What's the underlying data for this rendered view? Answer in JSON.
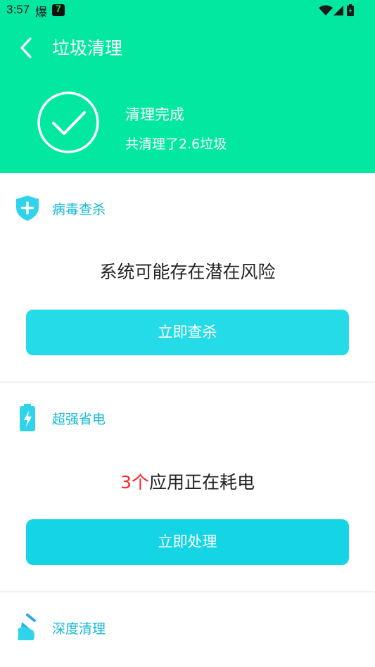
{
  "status_bar": {
    "time": "3:57",
    "notification_glyph": "爆",
    "app_badge": "7",
    "icons": [
      "wifi-icon",
      "signal-icon",
      "battery-icon"
    ]
  },
  "header": {
    "title": "垃圾清理",
    "back_icon": "chevron-left-icon"
  },
  "result": {
    "title": "清理完成",
    "subtitle": "共清理了2.6垃圾",
    "icon": "check-circle-icon"
  },
  "virus": {
    "label": "病毒查杀",
    "icon": "shield-plus-icon",
    "message": "系统可能存在潜在风险",
    "button": "立即查杀"
  },
  "power": {
    "label": "超强省电",
    "icon": "battery-bolt-icon",
    "message_count": "3个",
    "message_rest": "应用正在耗电",
    "button": "立即处理"
  },
  "deep": {
    "label": "深度清理",
    "icon": "broom-icon"
  },
  "colors": {
    "header_bg": "#03e8a0",
    "accent": "#17b8d4",
    "button_bg": "#26dbe8",
    "highlight": "#ff2020"
  }
}
